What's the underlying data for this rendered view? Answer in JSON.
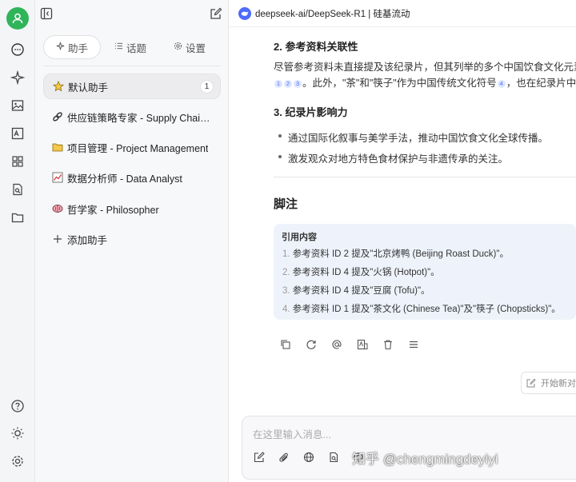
{
  "model": {
    "name": "deepseek-ai/DeepSeek-R1 | 硅基流动",
    "logo_color": "#4d6bfe"
  },
  "sidebar": {
    "tabs": [
      {
        "label": "助手",
        "icon": "sparkle-icon"
      },
      {
        "label": "话题",
        "icon": "list-icon"
      },
      {
        "label": "设置",
        "icon": "gear-icon"
      }
    ],
    "assistants": [
      {
        "label": "默认助手",
        "icon": "star-emoji",
        "badge": "1",
        "active": true
      },
      {
        "label": "供应链策略专家 - Supply Chain…",
        "icon": "chain-emoji"
      },
      {
        "label": "项目管理 - Project Management",
        "icon": "folder-emoji"
      },
      {
        "label": "数据分析师 - Data Analyst",
        "icon": "chart-emoji"
      },
      {
        "label": "哲学家 - Philosopher",
        "icon": "brain-emoji"
      }
    ],
    "add_label": "添加助手"
  },
  "content": {
    "section2": {
      "heading": "2. 参考资料关联性",
      "line1": "尽管参考资料未直接提及该纪录片，但其列举的多个中国饮食文化元素",
      "line2_a": "。此外，\"茶\"和\"筷子\"作为中国传统文化符号",
      "line2_b": "，也在纪录片中频",
      "cites_a": [
        "1",
        "2",
        "3"
      ],
      "cite_b": "4"
    },
    "section3": {
      "heading": "3. 纪录片影响力",
      "bullets": [
        "通过国际化叙事与美学手法，推动中国饮食文化全球传播。",
        "激发观众对地方特色食材保护与非遗传承的关注。"
      ]
    },
    "footnote": {
      "heading": "脚注",
      "box_title": "引用内容",
      "items": [
        {
          "n": "1.",
          "text": "参考资料 ID 2 提及\"北京烤鸭 (Beijing Roast Duck)\"。"
        },
        {
          "n": "2.",
          "text": "参考资料 ID 4 提及\"火锅 (Hotpot)\"。"
        },
        {
          "n": "3.",
          "text": "参考资料 ID 4 提及\"豆腐 (Tofu)\"。"
        },
        {
          "n": "4.",
          "text": "参考资料 ID 1 提及\"茶文化 (Chinese Tea)\"及\"筷子 (Chopsticks)\"。"
        }
      ]
    }
  },
  "new_topic_label": "开始新对",
  "input": {
    "placeholder": "在这里输入消息..."
  },
  "watermark": "知乎 @chengmingdeyiyi",
  "colors": {
    "accent": "#2fb45a",
    "cite_bg": "#dde6ff",
    "ref_bg": "#eef3fb"
  }
}
